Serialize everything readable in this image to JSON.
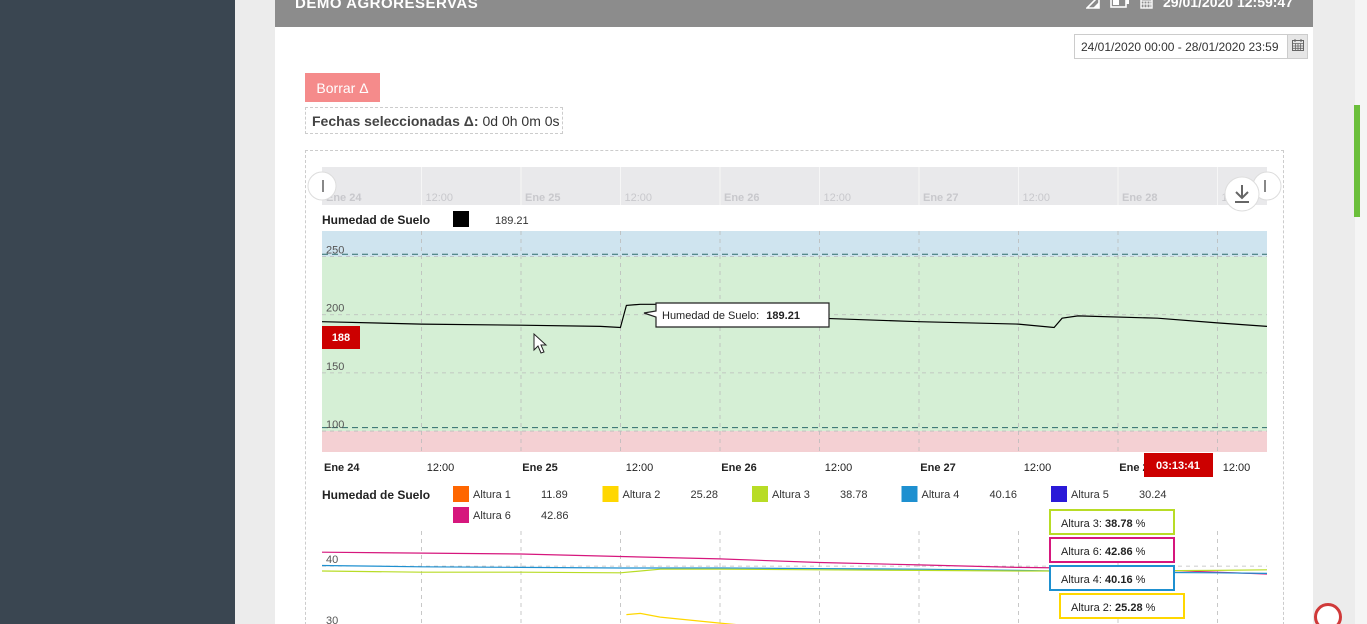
{
  "header": {
    "title": "DEMO AGRORESERVAS",
    "datetime": "29/01/2020 12:59:47"
  },
  "date_range": {
    "value": "24/01/2020 00:00 - 28/01/2020 23:59"
  },
  "actions": {
    "borrar_label": "Borrar Δ"
  },
  "selection": {
    "label": "Fechas seleccionadas Δ:",
    "value": "0d 0h 0m 0s"
  },
  "navigator": {
    "ticks": [
      "Ene 24",
      "12:00",
      "Ene 25",
      "12:00",
      "Ene 26",
      "12:00",
      "Ene 27",
      "12:00",
      "Ene 28",
      "12:00"
    ]
  },
  "chart_data": [
    {
      "type": "line",
      "legend": [
        {
          "name": "Humedad de Suelo",
          "color": "#000000",
          "value": "189.21"
        }
      ],
      "title": "Humedad de Suelo",
      "x": [
        "Ene 24",
        "12:00",
        "Ene 25",
        "12:00",
        "Ene 26",
        "12:00",
        "Ene 27",
        "12:00",
        "Ene 28",
        "12:00"
      ],
      "xlim_days": [
        0,
        4.75
      ],
      "ylim": [
        82,
        272
      ],
      "yticks": [
        100,
        150,
        200,
        250
      ],
      "bands": [
        {
          "from": 250,
          "to": 272,
          "color": "#cfe4ef"
        },
        {
          "from": 100,
          "to": 250,
          "color": "#d5efd5"
        },
        {
          "from": 82,
          "to": 100,
          "color": "#f4d0d3"
        }
      ],
      "plot_lines": [
        252,
        103
      ],
      "series": [
        {
          "name": "Humedad de Suelo",
          "color": "#000000",
          "points": [
            [
              0,
              194
            ],
            [
              0.5,
              192
            ],
            [
              1.0,
              191
            ],
            [
              1.4,
              190
            ],
            [
              1.5,
              189
            ],
            [
              1.53,
              208
            ],
            [
              1.6,
              209
            ],
            [
              1.7,
              209
            ],
            [
              2.0,
              206
            ],
            [
              2.5,
              197
            ],
            [
              3.0,
              194
            ],
            [
              3.5,
              192
            ],
            [
              3.68,
              189
            ],
            [
              3.72,
              197
            ],
            [
              3.8,
              199
            ],
            [
              4.2,
              197
            ],
            [
              4.5,
              193
            ],
            [
              4.75,
              190
            ]
          ]
        }
      ],
      "tooltip": {
        "label": "Humedad de Suelo:",
        "value": "189.21"
      },
      "y_marker": "188",
      "x_marker": "03:13:41"
    },
    {
      "type": "line",
      "title": "Humedad de Suelo",
      "legend": [
        {
          "name": "Altura 1",
          "color": "#ff6600",
          "value": "11.89"
        },
        {
          "name": "Altura 2",
          "color": "#ffd700",
          "value": "25.28"
        },
        {
          "name": "Altura 3",
          "color": "#b8dc26",
          "value": "38.78"
        },
        {
          "name": "Altura 4",
          "color": "#1e90d0",
          "value": "40.16"
        },
        {
          "name": "Altura 5",
          "color": "#2a1ad8",
          "value": "30.24"
        },
        {
          "name": "Altura 6",
          "color": "#d6177d",
          "value": "42.86"
        }
      ],
      "xlim_days": [
        0,
        4.75
      ],
      "ylim": [
        29.3,
        42.5
      ],
      "yticks": [
        30,
        40
      ],
      "unit": "%",
      "series": [
        {
          "name": "Altura 6",
          "color": "#d6177d",
          "points": [
            [
              0,
              42.3
            ],
            [
              1.0,
              42.0
            ],
            [
              1.5,
              41.6
            ],
            [
              2.0,
              41.2
            ],
            [
              2.5,
              40.6
            ],
            [
              3.0,
              40.2
            ],
            [
              3.5,
              39.8
            ],
            [
              4.0,
              39.6
            ],
            [
              4.5,
              39.0
            ],
            [
              4.75,
              38.7
            ]
          ]
        },
        {
          "name": "Altura 4",
          "color": "#1e90d0",
          "points": [
            [
              0,
              40.1
            ],
            [
              0.5,
              39.9
            ],
            [
              1.0,
              39.8
            ],
            [
              1.5,
              39.7
            ],
            [
              2.0,
              39.7
            ],
            [
              2.5,
              39.6
            ],
            [
              3.0,
              39.5
            ],
            [
              3.5,
              39.3
            ],
            [
              4.0,
              39.0
            ],
            [
              4.5,
              38.9
            ],
            [
              4.75,
              38.8
            ]
          ]
        },
        {
          "name": "Altura 3",
          "color": "#b8dc26",
          "points": [
            [
              0,
              39.2
            ],
            [
              0.5,
              39.0
            ],
            [
              1.0,
              39.0
            ],
            [
              1.5,
              38.9
            ],
            [
              1.7,
              39.5
            ],
            [
              2.0,
              39.5
            ],
            [
              2.5,
              39.4
            ],
            [
              3.0,
              39.3
            ],
            [
              3.5,
              39.2
            ],
            [
              4.0,
              39.2
            ],
            [
              4.5,
              39.3
            ],
            [
              4.75,
              39.4
            ]
          ]
        },
        {
          "name": "Altura 5",
          "color": "#2a1ad8",
          "points": [
            [
              0,
              30.1
            ],
            [
              1.0,
              29.8
            ],
            [
              2.0,
              29.6
            ]
          ]
        },
        {
          "name": "Altura 2",
          "color": "#ffd700",
          "points": [
            [
              1.53,
              32.0
            ],
            [
              1.6,
              32.2
            ],
            [
              1.7,
              31.6
            ],
            [
              2.0,
              30.6
            ],
            [
              2.3,
              29.7
            ]
          ]
        }
      ],
      "tooltips": [
        {
          "label": "Altura 3:",
          "value": "38.78",
          "unit": "%",
          "color": "#b8dc26"
        },
        {
          "label": "Altura 6:",
          "value": "42.86",
          "unit": "%",
          "color": "#d6177d"
        },
        {
          "label": "Altura 4:",
          "value": "40.16",
          "unit": "%",
          "color": "#1e90d0"
        },
        {
          "label": "Altura 2:",
          "value": "25.28",
          "unit": "%",
          "color": "#ffd700"
        }
      ]
    }
  ]
}
